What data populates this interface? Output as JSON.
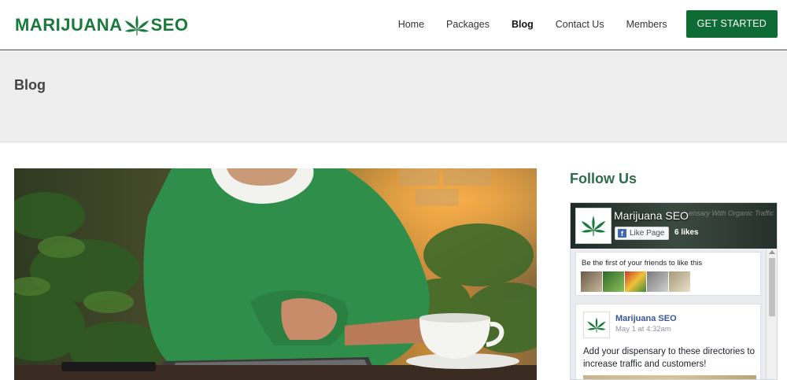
{
  "header": {
    "logo_left": "MARIJUANA",
    "logo_right": "SEO",
    "nav": [
      {
        "label": "Home",
        "active": false
      },
      {
        "label": "Packages",
        "active": false
      },
      {
        "label": "Blog",
        "active": true
      },
      {
        "label": "Contact Us",
        "active": false
      },
      {
        "label": "Members",
        "active": false
      }
    ],
    "cta_label": "GET STARTED"
  },
  "page": {
    "title": "Blog"
  },
  "sidebar": {
    "follow_title": "Follow Us",
    "facebook": {
      "page_name": "Marijuana SEO",
      "cover_text": "ensary With Organic Traffic",
      "like_button": "Like Page",
      "likes": "6 likes",
      "friends_text": "Be the first of your friends to like this",
      "post": {
        "author": "Marijuana SEO",
        "time": "May 1 at 4:32am",
        "text": "Add your dispensary to these directories to increase traffic and customers!"
      }
    }
  },
  "colors": {
    "brand_green": "#1a7a3c",
    "cta_green": "#0e6b33",
    "follow_green": "#2e6b4a",
    "facebook_blue": "#4267b2"
  },
  "icons": [
    "cannabis-leaf-icon",
    "facebook-f-icon"
  ]
}
